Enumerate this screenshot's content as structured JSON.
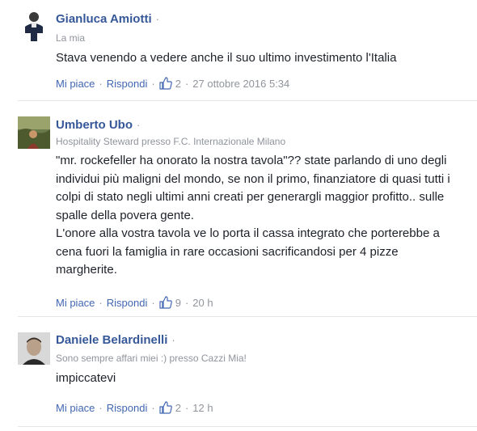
{
  "comments": [
    {
      "author": "Gianluca Amiotti",
      "subtitle": "La mia",
      "text": [
        "Stava venendo a vedere anche il suo ultimo investimento l'Italia"
      ],
      "like_label": "Mi piace",
      "reply_label": "Rispondi",
      "like_count": "2",
      "timestamp": "27 ottobre 2016 5:34"
    },
    {
      "author": "Umberto Ubo",
      "subtitle": "Hospitality Steward presso F.C. Internazionale Milano",
      "text": [
        "\"mr. rockefeller ha onorato la nostra tavola\"?? state parlando di uno degli individui più maligni del mondo, se non il primo, finanziatore di quasi tutti i colpi di stato negli ultimi anni creati per generargli maggior profitto.. sulle spalle della povera gente.",
        "L'onore alla vostra tavola ve lo porta il cassa integrato che porterebbe a cena fuori la famiglia in rare occasioni sacrificandosi per 4 pizze margherite."
      ],
      "like_label": "Mi piace",
      "reply_label": "Rispondi",
      "like_count": "9",
      "timestamp": "20 h"
    },
    {
      "author": "Daniele Belardinelli",
      "subtitle": "Sono sempre affari miei :) presso Cazzi Mia!",
      "text": [
        "impiccatevi"
      ],
      "like_label": "Mi piace",
      "reply_label": "Rispondi",
      "like_count": "2",
      "timestamp": "12 h"
    }
  ],
  "colors": {
    "name": "#365899",
    "link": "#4267b2",
    "meta": "#90949c",
    "text": "#1d2129",
    "divider": "#e5e6e9"
  }
}
